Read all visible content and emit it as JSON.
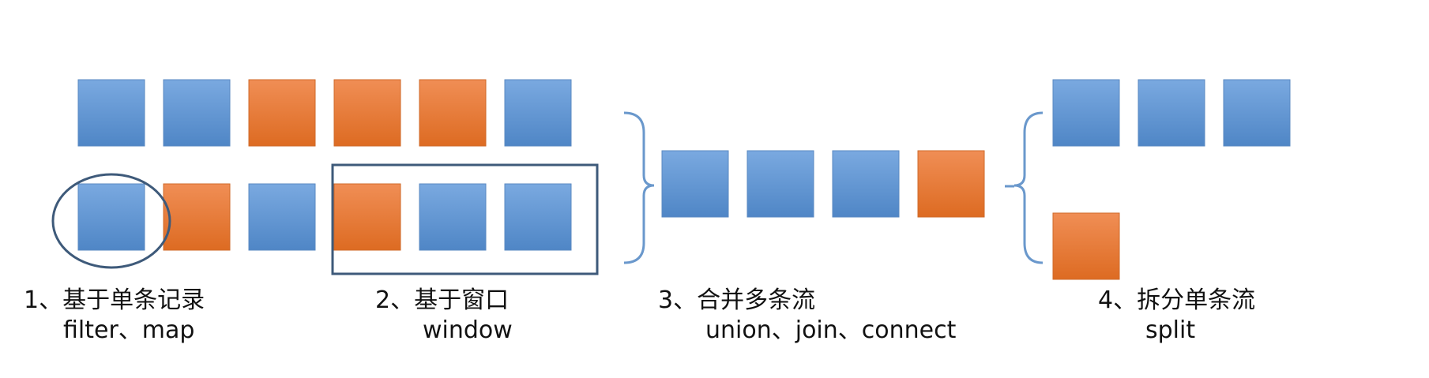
{
  "colors": {
    "blue": "#5b8fcf",
    "orange": "#e47a35",
    "outline": "#3e5a7a",
    "bracket": "#6a98cc"
  },
  "streams": {
    "input_top": [
      "blue",
      "blue",
      "orange",
      "orange",
      "orange",
      "blue"
    ],
    "input_bottom": [
      "blue",
      "orange",
      "blue",
      "orange",
      "blue",
      "blue"
    ],
    "merged": [
      "blue",
      "blue",
      "blue",
      "orange"
    ],
    "split_top": [
      "blue",
      "blue",
      "blue"
    ],
    "split_bottom": [
      "orange"
    ]
  },
  "labels": {
    "step1": {
      "title": "1、基于单条记录",
      "ops": "filter、map"
    },
    "step2": {
      "title": "2、基于窗口",
      "ops": "window"
    },
    "step3": {
      "title": "3、合并多条流",
      "ops": "union、join、connect"
    },
    "step4": {
      "title": "4、拆分单条流",
      "ops": "split"
    }
  }
}
